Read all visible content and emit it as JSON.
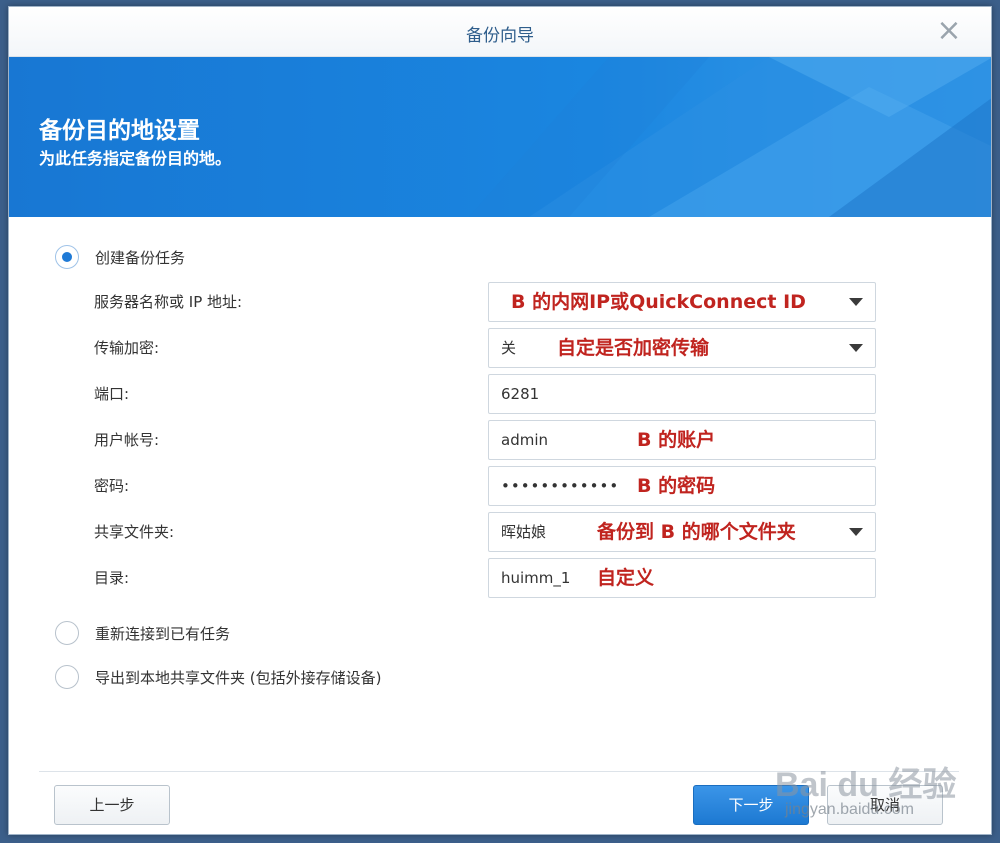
{
  "window": {
    "title": "备份向导"
  },
  "banner": {
    "title": "备份目的地设置",
    "subtitle": "为此任务指定备份目的地。"
  },
  "options": {
    "create": "创建备份任务",
    "reconnect": "重新连接到已有任务",
    "export": "导出到本地共享文件夹 (包括外接存储设备)"
  },
  "fields": {
    "server": {
      "label": "服务器名称或 IP 地址:",
      "value": "",
      "note": "B 的内网IP或QuickConnect ID"
    },
    "encryption": {
      "label": "传输加密:",
      "value": "关",
      "note": "自定是否加密传输"
    },
    "port": {
      "label": "端口:",
      "value": "6281"
    },
    "account": {
      "label": "用户帐号:",
      "value": "admin",
      "note": "B 的账户"
    },
    "password": {
      "label": "密码:",
      "value": "••••••••••••",
      "note": "B 的密码"
    },
    "shared_folder": {
      "label": "共享文件夹:",
      "value": "晖姑娘",
      "note": "备份到 B 的哪个文件夹"
    },
    "directory": {
      "label": "目录:",
      "value": "huimm_1",
      "note": "自定义"
    }
  },
  "buttons": {
    "prev": "上一步",
    "next": "下一步",
    "cancel": "取消"
  },
  "watermark": {
    "text": "Bai du 经验",
    "sub": "jingyan.baidu.com"
  },
  "colors": {
    "accent": "#1f7ad6",
    "banner": "#1a7fd8",
    "note": "#c0241f"
  }
}
